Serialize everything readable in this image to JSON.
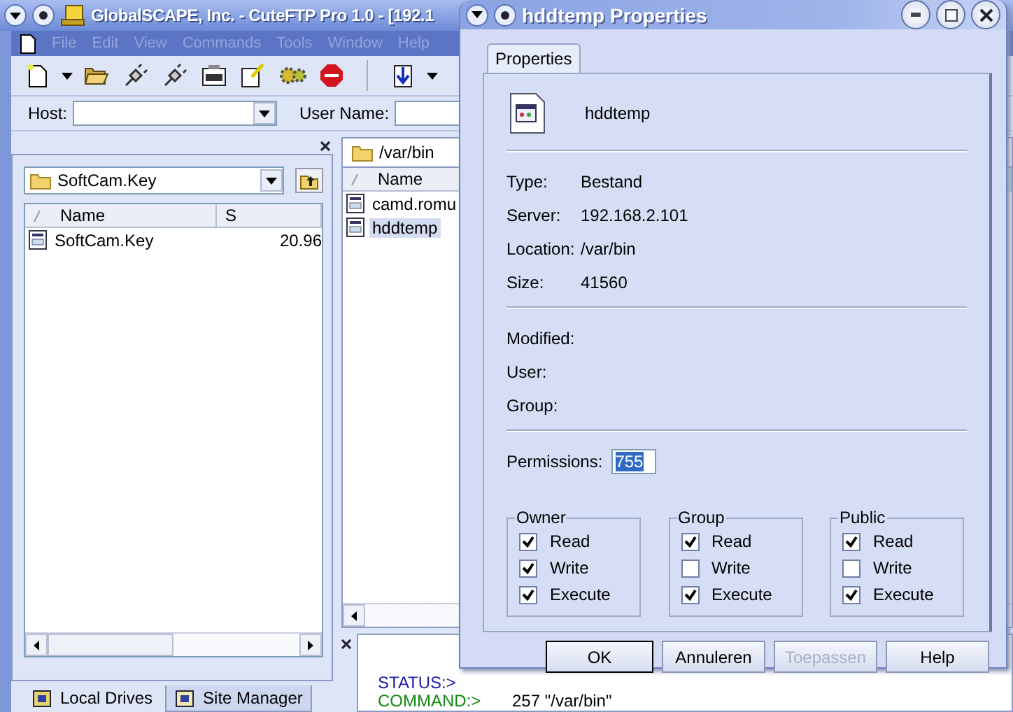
{
  "main_window": {
    "title": "GlobalSCAPE, Inc. - CuteFTP Pro 1.0 - [192.1",
    "menu": [
      {
        "label": "File",
        "disabled": true
      },
      {
        "label": "Edit",
        "disabled": true
      },
      {
        "label": "View",
        "disabled": true
      },
      {
        "label": "Commands",
        "disabled": true
      },
      {
        "label": "Tools",
        "disabled": true
      },
      {
        "label": "Window",
        "disabled": true
      },
      {
        "label": "Help",
        "disabled": true
      }
    ]
  },
  "host_bar": {
    "host_label": "Host:",
    "user_label": "User Name:"
  },
  "local_pane": {
    "path": "SoftCam.Key",
    "columns": [
      "Name",
      "S"
    ],
    "rows": [
      {
        "name": "SoftCam.Key",
        "size": "20.96"
      }
    ],
    "tabs": [
      {
        "label": "Local Drives",
        "selected": true
      },
      {
        "label": "Site Manager",
        "selected": false
      }
    ]
  },
  "remote_pane": {
    "path": "/var/bin",
    "columns": [
      "Name"
    ],
    "rows": [
      {
        "name": "camd.romu",
        "selected": false
      },
      {
        "name": "hddtemp",
        "selected": true
      }
    ]
  },
  "log": [
    {
      "kind": "status",
      "prefix": "STATUS:>"
    },
    {
      "kind": "command",
      "prefix": "COMMAND:>"
    },
    {
      "kind": "reply",
      "text": "257 \"/var/bin\""
    }
  ],
  "dialog": {
    "title": "hddtemp Properties",
    "tab": {
      "label": "Properties",
      "selected": true
    },
    "file_name": "hddtemp",
    "info": [
      {
        "label": "Type:",
        "value": "Bestand"
      },
      {
        "label": "Server:",
        "value": "192.168.2.101"
      },
      {
        "label": "Location:",
        "value": "/var/bin"
      },
      {
        "label": "Size:",
        "value": "41560"
      }
    ],
    "meta": [
      {
        "label": "Modified:"
      },
      {
        "label": "User:"
      },
      {
        "label": "Group:"
      }
    ],
    "permissions_label": "Permissions:",
    "permissions_value": "755",
    "groups": [
      {
        "title": "Owner",
        "options": [
          {
            "label": "Read",
            "checked": true
          },
          {
            "label": "Write",
            "checked": true
          },
          {
            "label": "Execute",
            "checked": true
          }
        ]
      },
      {
        "title": "Group",
        "options": [
          {
            "label": "Read",
            "checked": true
          },
          {
            "label": "Write",
            "checked": false
          },
          {
            "label": "Execute",
            "checked": true
          }
        ]
      },
      {
        "title": "Public",
        "options": [
          {
            "label": "Read",
            "checked": true
          },
          {
            "label": "Write",
            "checked": false
          },
          {
            "label": "Execute",
            "checked": true
          }
        ]
      }
    ],
    "buttons": [
      {
        "label": "OK",
        "default": true,
        "disabled": false
      },
      {
        "label": "Annuleren",
        "default": false,
        "disabled": false
      },
      {
        "label": "Toepassen",
        "default": false,
        "disabled": true
      },
      {
        "label": "Help",
        "default": false,
        "disabled": false
      }
    ]
  }
}
